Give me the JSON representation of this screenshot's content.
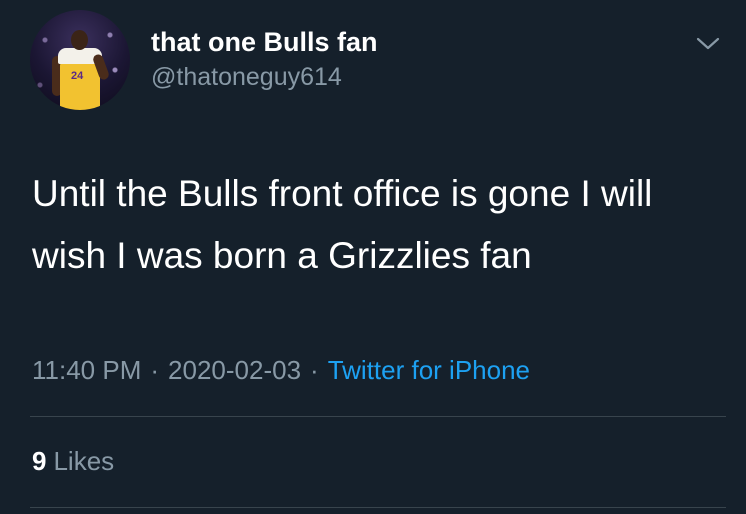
{
  "tweet": {
    "display_name": "that one Bulls fan",
    "handle": "@thatoneguy614",
    "text": "Until the Bulls front office is gone I will wish I was born a Grizzlies fan",
    "time": "11:40 PM",
    "separator": "·",
    "date": "2020-02-03",
    "source": "Twitter for iPhone",
    "likes_count": "9",
    "likes_label": "Likes",
    "avatar_jersey_number": "24",
    "menu_icon": "chevron-down-icon"
  },
  "colors": {
    "background": "#15202b",
    "primary_text": "#ffffff",
    "secondary_text": "#8899a6",
    "link": "#1da1f2",
    "divider": "#38444d"
  }
}
